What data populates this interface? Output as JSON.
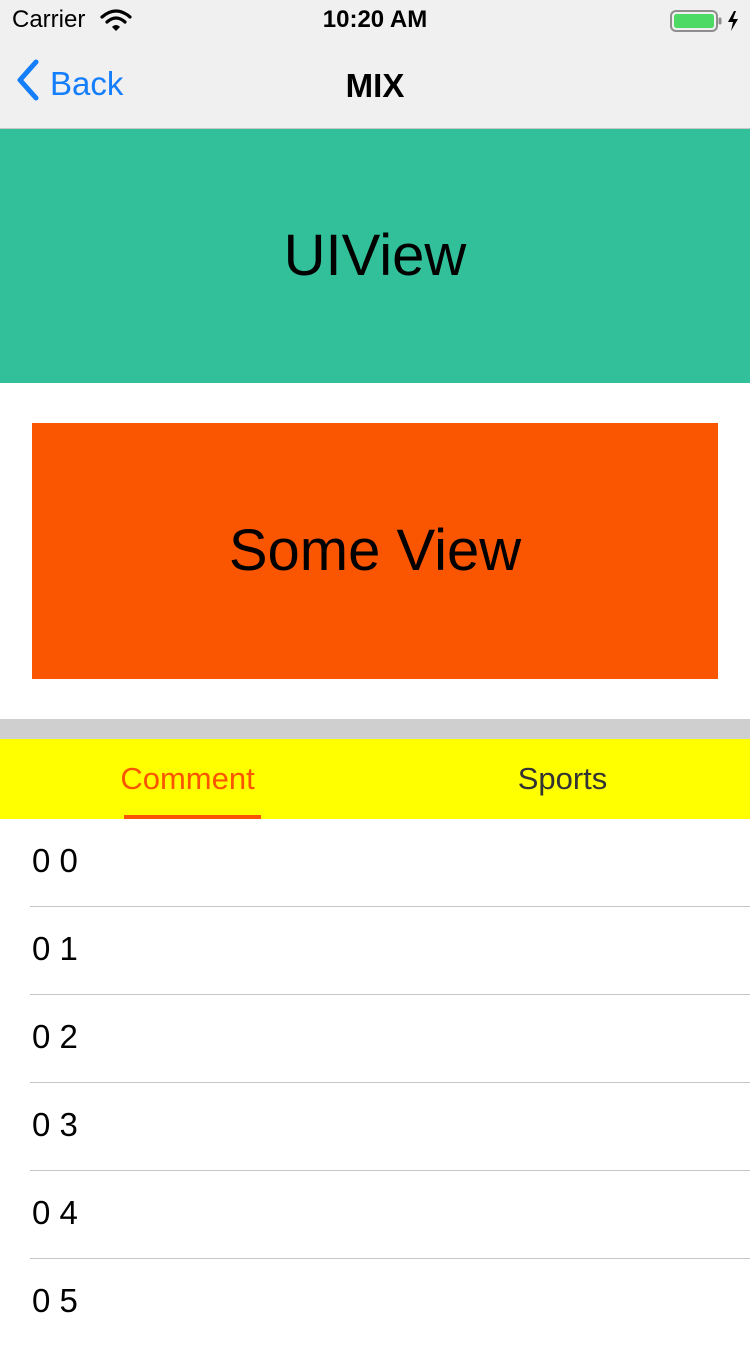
{
  "status_bar": {
    "carrier": "Carrier",
    "time": "10:20 AM"
  },
  "nav": {
    "back_label": "Back",
    "title": "MIX"
  },
  "uiview": {
    "label": "UIView",
    "color": "#31c099"
  },
  "some_view": {
    "label": "Some View",
    "color": "#fa5500"
  },
  "tabs": {
    "items": [
      {
        "label": "Comment",
        "selected": true
      },
      {
        "label": "Sports",
        "selected": false
      }
    ],
    "background": "#ffff00",
    "selected_color": "#fa5500",
    "normal_color": "#333333"
  },
  "list": {
    "items": [
      {
        "label": "0 0"
      },
      {
        "label": "0 1"
      },
      {
        "label": "0 2"
      },
      {
        "label": "0 3"
      },
      {
        "label": "0 4"
      },
      {
        "label": "0 5"
      }
    ]
  },
  "colors": {
    "ios_blue": "#147efb",
    "battery_green": "#4cd964"
  }
}
